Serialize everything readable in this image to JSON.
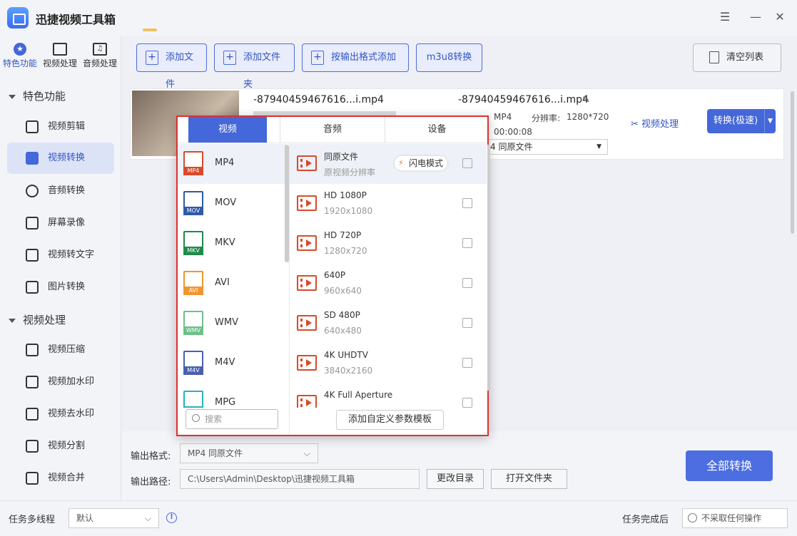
{
  "app": {
    "title": "迅捷视频工具箱"
  },
  "sidebar": {
    "top_tabs": [
      {
        "label": "特色功能"
      },
      {
        "label": "视频处理"
      },
      {
        "label": "音频处理"
      }
    ],
    "groups": [
      {
        "title": "特色功能",
        "items": [
          {
            "label": "视频剪辑"
          },
          {
            "label": "视频转换"
          },
          {
            "label": "音频转换"
          },
          {
            "label": "屏幕录像"
          },
          {
            "label": "视频转文字"
          },
          {
            "label": "图片转换"
          }
        ]
      },
      {
        "title": "视频处理",
        "items": [
          {
            "label": "视频压缩"
          },
          {
            "label": "视频加水印"
          },
          {
            "label": "视频去水印"
          },
          {
            "label": "视频分割"
          },
          {
            "label": "视频合并"
          }
        ]
      }
    ]
  },
  "toolbar": {
    "add_file": "添加文件",
    "add_folder": "添加文件夹",
    "add_by_format": "按输出格式添加",
    "m3u8": "m3u8转换",
    "clear": "清空列表"
  },
  "file": {
    "src_name": "-87940459467616...i.mp4",
    "dst_name": "-87940459467616...i.mp4",
    "dst_format": "MP4",
    "resolution_label": "分辨率:",
    "resolution": "1280*720",
    "duration": "00:00:08",
    "dst_select": "4   同原文件",
    "video_process": "视频处理",
    "convert": "转换(极速)"
  },
  "popup": {
    "tabs": [
      {
        "label": "视频"
      },
      {
        "label": "音频"
      },
      {
        "label": "设备"
      }
    ],
    "formats": [
      {
        "name": "MP4",
        "color": "#d84a2b"
      },
      {
        "name": "MOV",
        "color": "#2f5aa8"
      },
      {
        "name": "MKV",
        "color": "#1f8a4c"
      },
      {
        "name": "AVI",
        "color": "#f0962e"
      },
      {
        "name": "WMV",
        "color": "#6cc08a"
      },
      {
        "name": "M4V",
        "color": "#4a5fb0"
      },
      {
        "name": "MPG",
        "color": "#2ab0b8"
      }
    ],
    "presets": [
      {
        "title": "同原文件",
        "sub": "原视频分辨率"
      },
      {
        "title": "HD 1080P",
        "sub": "1920x1080"
      },
      {
        "title": "HD 720P",
        "sub": "1280x720"
      },
      {
        "title": "640P",
        "sub": "960x640"
      },
      {
        "title": "SD 480P",
        "sub": "640x480"
      },
      {
        "title": "4K UHDTV",
        "sub": "3840x2160"
      },
      {
        "title": "4K Full Aperture",
        "sub": ""
      }
    ],
    "flash_mode": "闪电模式",
    "search_placeholder": "搜索",
    "add_template": "添加自定义参数模板"
  },
  "output": {
    "format_label": "输出格式:",
    "format_value": "MP4   同原文件",
    "path_label": "输出路径:",
    "path_value": "C:\\Users\\Admin\\Desktop\\迅捷视频工具箱",
    "change_dir": "更改目录",
    "open_folder": "打开文件夹",
    "convert_all": "全部转换"
  },
  "status": {
    "multithread_label": "任务多线程",
    "multithread_value": "默认",
    "after_label": "任务完成后",
    "after_value": "不采取任何操作"
  }
}
